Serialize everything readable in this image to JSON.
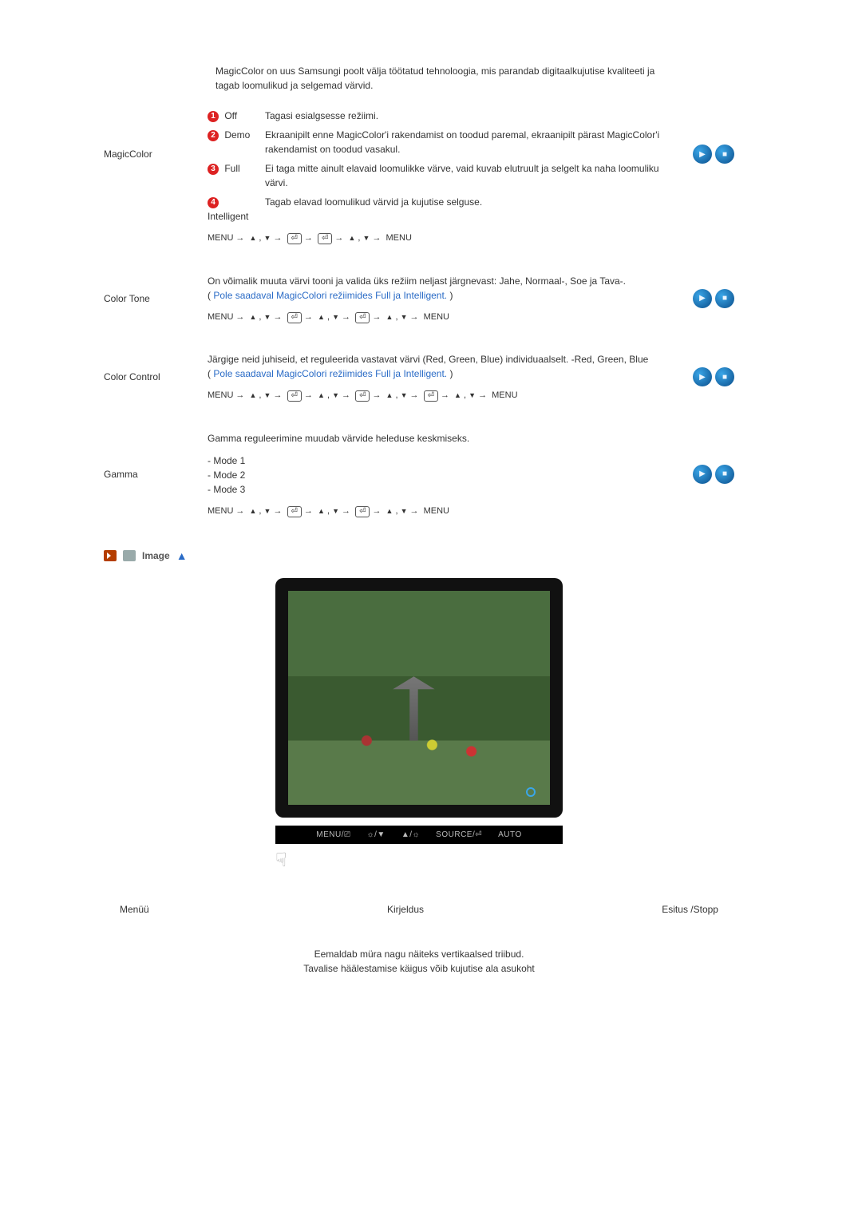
{
  "magiccolor": {
    "label": "MagicColor",
    "intro": "MagicColor on uus Samsungi poolt välja töötatud tehnoloogia, mis parandab digitaalkujutise kvaliteeti ja tagab loomulikud ja selgemad värvid.",
    "opts": {
      "off": {
        "name": "Off",
        "desc": "Tagasi esialgsesse režiimi."
      },
      "demo": {
        "name": "Demo",
        "desc": "Ekraanipilt enne MagicColor'i rakendamist on toodud paremal, ekraanipilt pärast MagicColor'i rakendamist on toodud vasakul."
      },
      "full": {
        "name": "Full",
        "desc": "Ei taga mitte ainult elavaid loomulikke värve, vaid kuvab elutruult ja selgelt ka naha loomuliku värvi."
      },
      "intelligent": {
        "name": "Intelligent",
        "desc": "Tagab elavad loomulikud värvid ja kujutise selguse."
      }
    },
    "path_a": "MENU",
    "path_z": "MENU"
  },
  "colortone": {
    "label": "Color Tone",
    "body": "On võimalik muuta värvi tooni ja valida üks režiim neljast järgnevast: Jahe, Normaal-, Soe ja Tava-.",
    "note": "Pole saadaval MagicColori režiimides Full ja Intelligent."
  },
  "colorcontrol": {
    "label": "Color Control",
    "body": "Järgige neid juhiseid, et reguleerida vastavat värvi (Red, Green, Blue) individuaalselt. -Red, Green, Blue",
    "note": "Pole saadaval MagicColori režiimides Full ja Intelligent."
  },
  "gamma": {
    "label": "Gamma",
    "body": "Gamma reguleerimine muudab värvide heleduse keskmiseks.",
    "m1": "- Mode 1",
    "m2": "- Mode 2",
    "m3": "- Mode 3"
  },
  "section_image": "Image",
  "btnbar": {
    "menu": "MENU/⎚",
    "bright": "☼/▼",
    "vol": "▲/☼",
    "source": "SOURCE/⏎",
    "auto": "AUTO"
  },
  "hdr3": {
    "menu": "Menüü",
    "desc": "Kirjeldus",
    "play": "Esitus /Stopp"
  },
  "coarse": "Eemaldab müra nagu näiteks vertikaalsed triibud.\nTavalise häälestamise käigus võib kujutise ala asukoht",
  "glyphs": {
    "arrow": "→",
    "up": "▲",
    "down": "▼",
    "enter": "⏎"
  }
}
